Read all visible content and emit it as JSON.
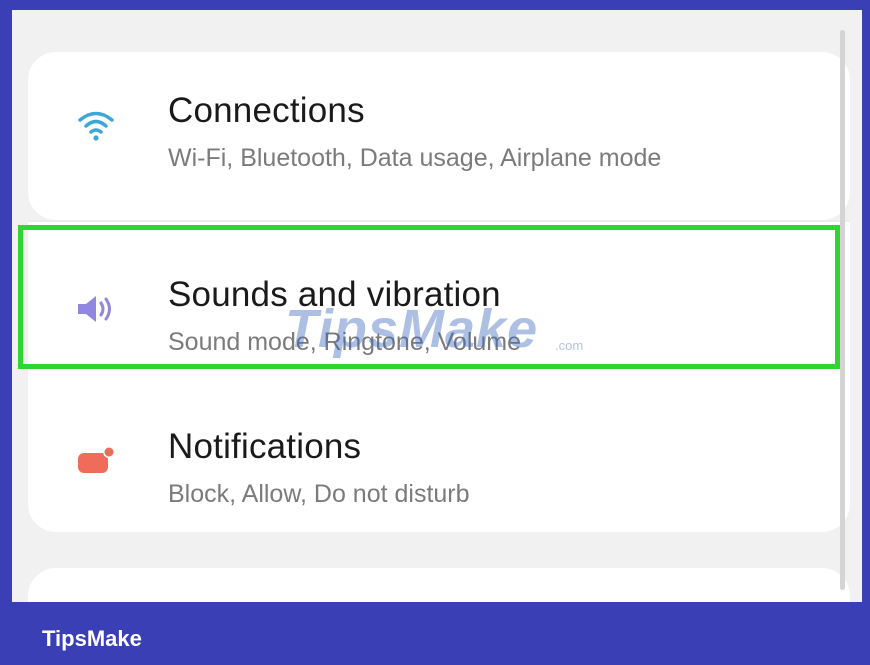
{
  "settings": {
    "items": [
      {
        "title": "Connections",
        "subtitle": "Wi-Fi, Bluetooth, Data usage, Airplane mode",
        "icon": "wifi-icon",
        "icon_color": "#3ea6d6"
      },
      {
        "title": "Sounds and vibration",
        "subtitle": "Sound mode, Ringtone, Volume",
        "icon": "volume-icon",
        "icon_color": "#8f87e0"
      },
      {
        "title": "Notifications",
        "subtitle": "Block, Allow, Do not disturb",
        "icon": "notification-icon",
        "icon_color": "#ef6b5a"
      }
    ]
  },
  "overlay": {
    "watermark": "TipsMake",
    "watermark_suffix": ".com",
    "highlight_color": "#2fd62f"
  },
  "footer": {
    "brand": "TipsMake"
  },
  "colors": {
    "frame": "#3b3fb5",
    "screen_bg": "#f1f1f1",
    "card_bg": "#ffffff"
  }
}
